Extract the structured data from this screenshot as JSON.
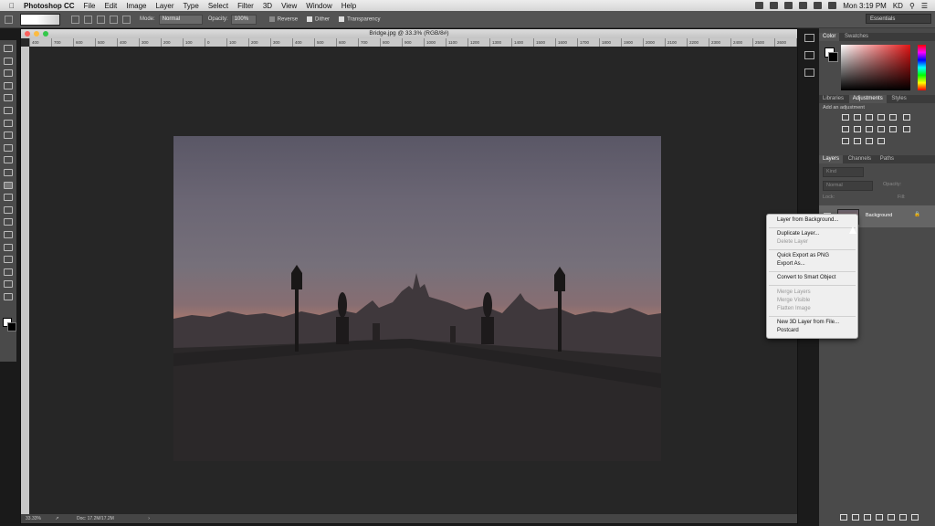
{
  "menubar": {
    "app_name": "Photoshop CC",
    "items": [
      "File",
      "Edit",
      "Image",
      "Layer",
      "Type",
      "Select",
      "Filter",
      "3D",
      "View",
      "Window",
      "Help"
    ],
    "clock": "Mon 3:19 PM",
    "user": "KD"
  },
  "options_bar": {
    "mode_label": "Mode:",
    "mode_value": "Normal",
    "opacity_label": "Opacity:",
    "opacity_value": "100%",
    "reverse_label": "Reverse",
    "dither_label": "Dither",
    "transparency_label": "Transparency",
    "workspace": "Essentials"
  },
  "document": {
    "title": "Bridge.jpg @ 33.3% (RGB/8#)",
    "ruler_ticks": [
      "400",
      "700",
      "600",
      "500",
      "400",
      "300",
      "200",
      "100",
      "0",
      "100",
      "200",
      "300",
      "400",
      "500",
      "600",
      "700",
      "800",
      "900",
      "1000",
      "1100",
      "1200",
      "1300",
      "1400",
      "1500",
      "1600",
      "1700",
      "1800",
      "1900",
      "2000",
      "2100",
      "2200",
      "2300",
      "2400",
      "2500",
      "2600",
      "2700",
      "2800",
      "2900",
      "3000",
      "3100",
      "3200",
      "3300",
      "3400",
      "3500",
      "3600",
      "3700"
    ],
    "zoom": "33.33%",
    "doc_info": "Doc: 17.2M/17.2M"
  },
  "panels": {
    "color_tabs": [
      "Color",
      "Swatches"
    ],
    "adjust_tabs": [
      "Libraries",
      "Adjustments",
      "Styles"
    ],
    "add_adjustment": "Add an adjustment",
    "layers_tabs": [
      "Layers",
      "Channels",
      "Paths"
    ],
    "kind_filter": "Kind",
    "blend_mode": "Normal",
    "opacity_label": "Opacity:",
    "lock_label": "Lock:",
    "fill_label": "Fill:",
    "layer_name": "Background"
  },
  "context_menu": {
    "items": [
      {
        "label": "Layer from Background...",
        "enabled": true
      },
      {
        "label": "Duplicate Layer...",
        "enabled": true
      },
      {
        "label": "Delete Layer",
        "enabled": false
      },
      {
        "label": "Quick Export as PNG",
        "enabled": true
      },
      {
        "label": "Export As...",
        "enabled": true
      },
      {
        "label": "Convert to Smart Object",
        "enabled": true
      },
      {
        "label": "Merge Layers",
        "enabled": false
      },
      {
        "label": "Merge Visible",
        "enabled": false
      },
      {
        "label": "Flatten Image",
        "enabled": false
      },
      {
        "label": "New 3D Layer from File...",
        "enabled": true
      },
      {
        "label": "Postcard",
        "enabled": true
      }
    ]
  },
  "colors": {
    "ui_dark": "#535353",
    "panel": "#4a4a4a",
    "canvas": "#262626",
    "menu_bg": "#efefef"
  }
}
